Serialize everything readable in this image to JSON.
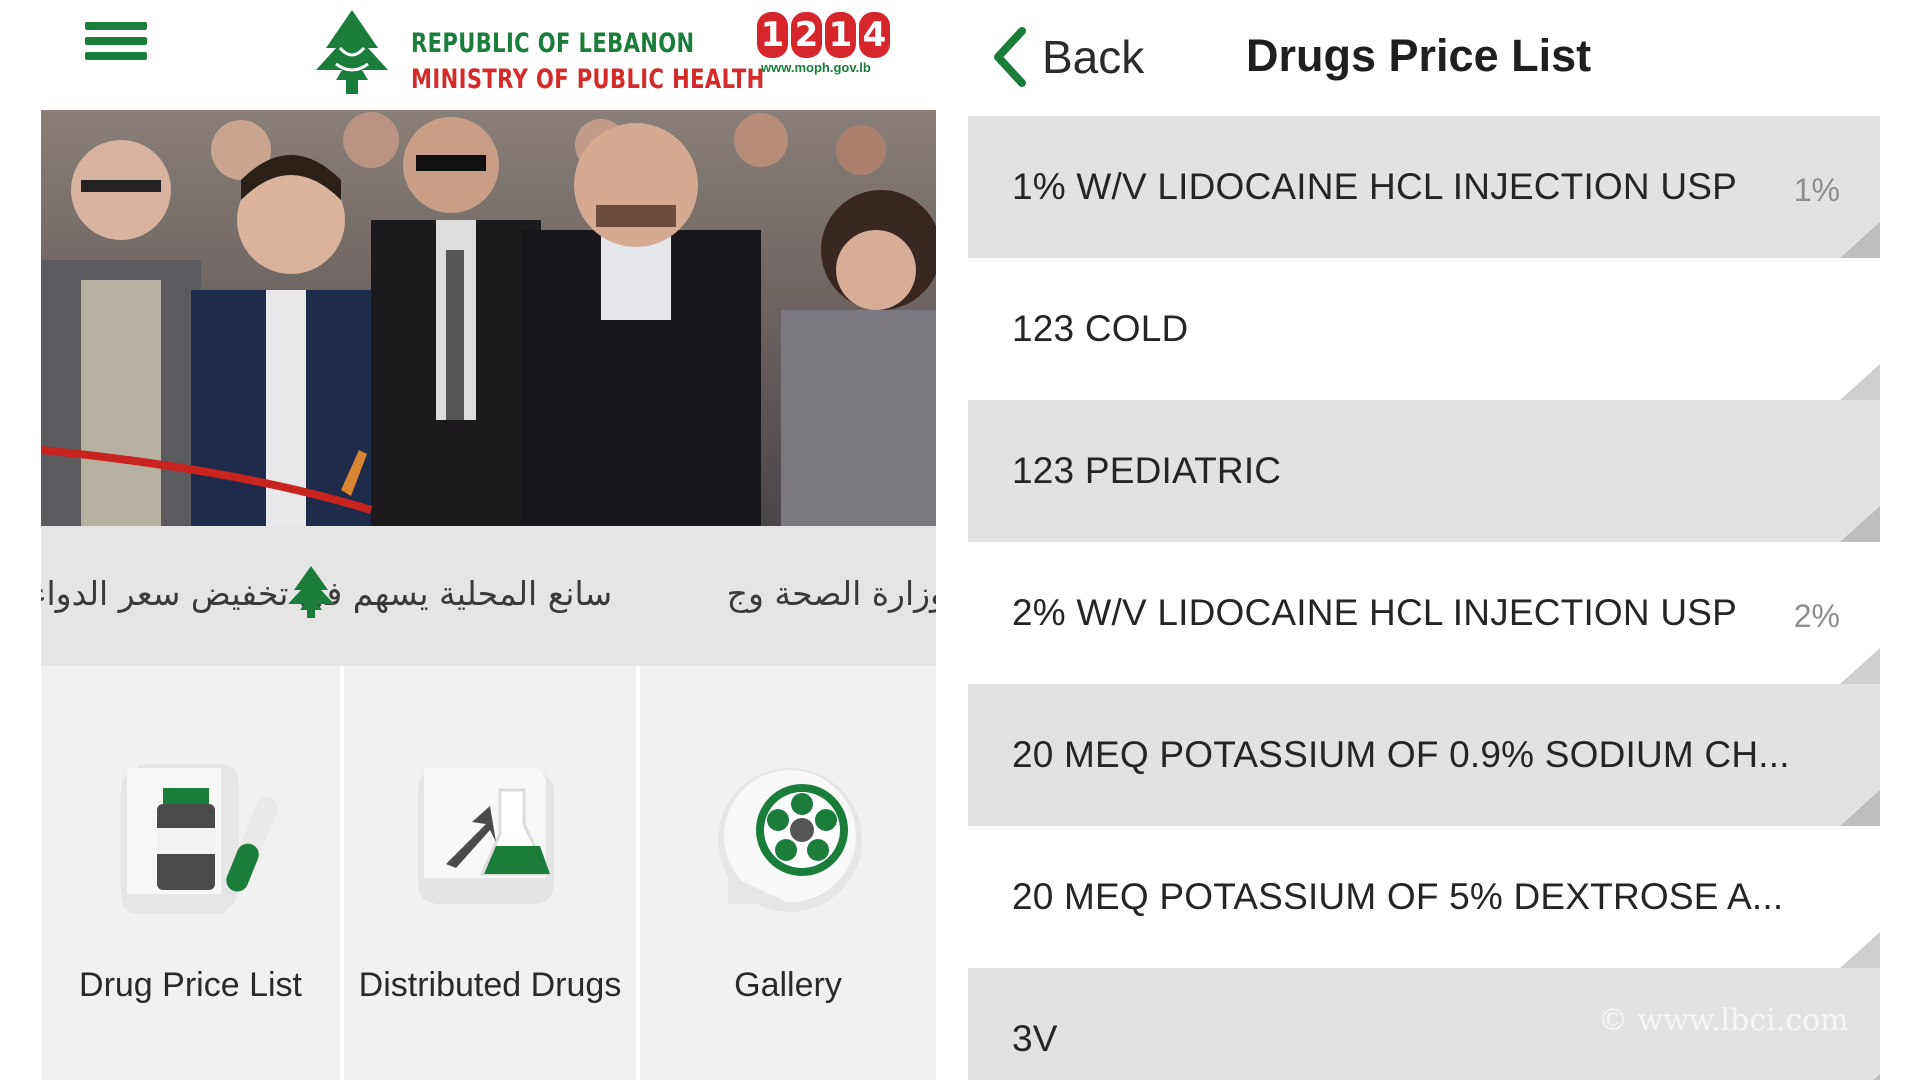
{
  "left_panel": {
    "header": {
      "logo_line1": "REPUBLIC OF LEBANON",
      "logo_line2": "MINISTRY OF PUBLIC HEALTH",
      "hotline_digits": [
        "1",
        "2",
        "1",
        "4"
      ],
      "hotline_url": "www.moph.gov.lb"
    },
    "ticker": {
      "text_right": "وزارة الصحة وج",
      "text_left": "سانع المحلية يسهم في تخفيض سعر الدواء"
    },
    "tiles": [
      {
        "label": "Drug Price List",
        "icon": "medicine-bottle-icon"
      },
      {
        "label": "Distributed Drugs",
        "icon": "distributed-flask-icon"
      },
      {
        "label": "Gallery",
        "icon": "gallery-film-reel-icon"
      }
    ]
  },
  "right_panel": {
    "nav": {
      "back_label": "Back",
      "title": "Drugs Price List"
    },
    "list": [
      {
        "name": "1% W/V LIDOCAINE HCL INJECTION USP",
        "badge": "1%"
      },
      {
        "name": "123 COLD",
        "badge": ""
      },
      {
        "name": "123 PEDIATRIC",
        "badge": ""
      },
      {
        "name": "2% W/V LIDOCAINE HCL INJECTION USP",
        "badge": "2%"
      },
      {
        "name": "20 MEQ POTASSIUM OF 0.9% SODIUM CH...",
        "badge": ""
      },
      {
        "name": "20 MEQ POTASSIUM OF 5% DEXTROSE A...",
        "badge": ""
      },
      {
        "name": "3V",
        "badge": ""
      }
    ],
    "watermark": "© www.lbci.com"
  },
  "colors": {
    "brand_green": "#1b7d3a",
    "brand_red": "#d42a2a",
    "row_grey": "#e2e2e2"
  }
}
